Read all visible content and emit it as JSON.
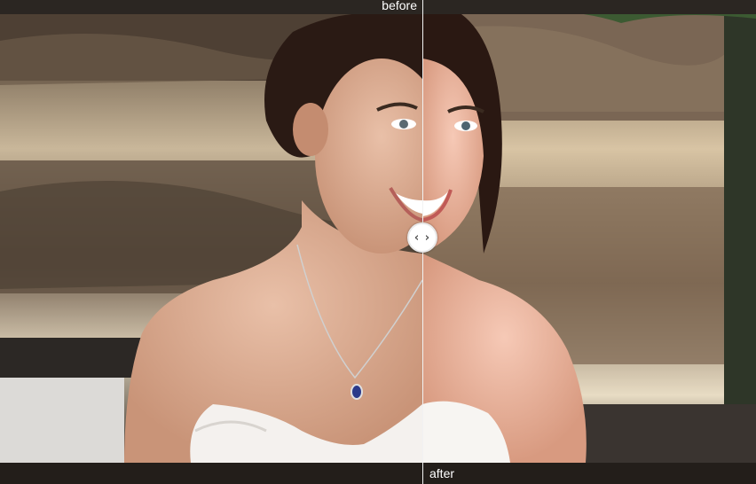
{
  "labels": {
    "before": "before",
    "after": "after"
  },
  "slider": {
    "handle_glyph": "‹ ›",
    "position_percent": 56
  },
  "colors": {
    "bars": "#231e1a",
    "divider": "#f2f2f2",
    "handle": "#ffffff",
    "label_text": "#ffffff"
  }
}
